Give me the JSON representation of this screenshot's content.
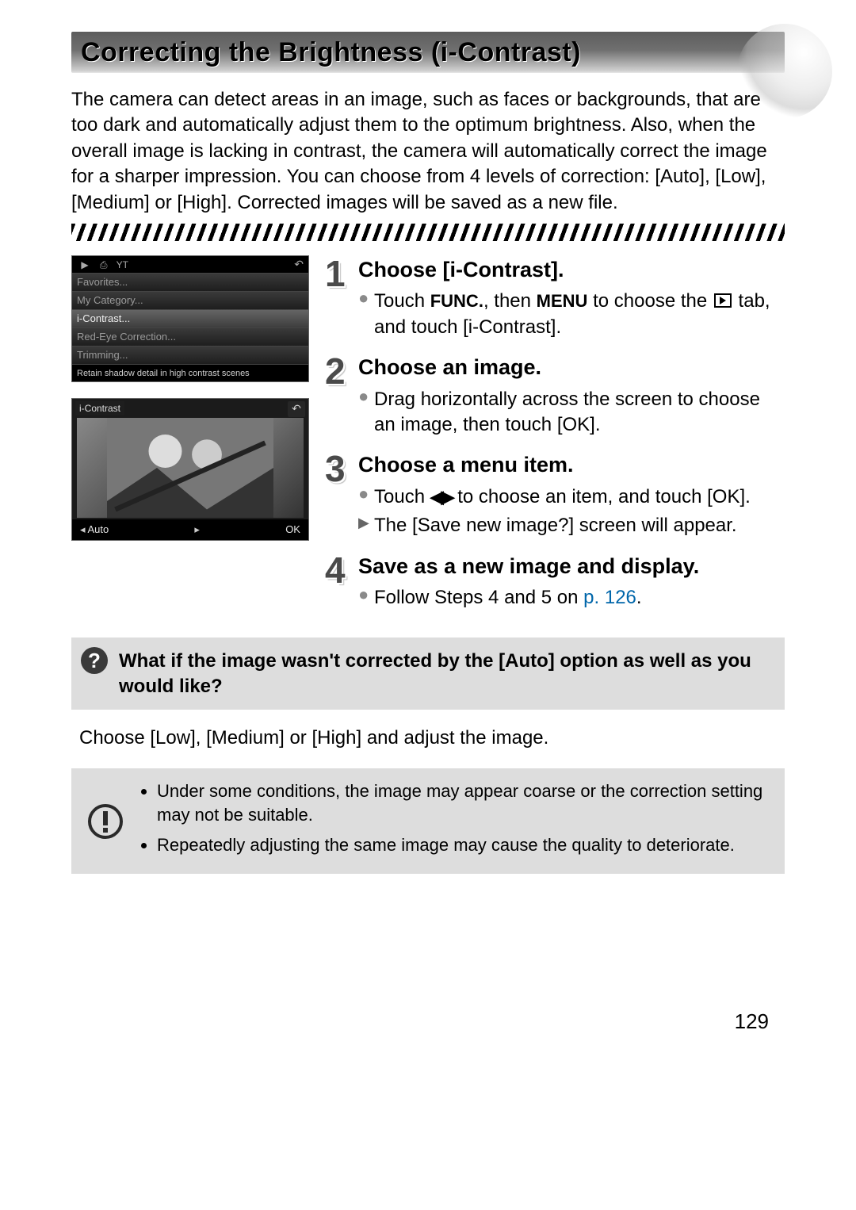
{
  "title": "Correcting the Brightness (i-Contrast)",
  "intro": "The camera can detect areas in an image, such as faces or backgrounds, that are too dark and automatically adjust them to the optimum brightness. Also, when the overall image is lacking in contrast, the camera will automatically correct the image for a sharper impression. You can choose from 4 levels of correction: [Auto], [Low], [Medium] or [High]. Corrected images will be saved as a new file.",
  "shot1": {
    "rows": [
      "Favorites...",
      "My Category...",
      "i-Contrast...",
      "Red-Eye Correction...",
      "Trimming..."
    ],
    "selected_index": 2,
    "footer": "Retain shadow detail in high contrast scenes"
  },
  "shot2": {
    "label": "i-Contrast",
    "setting": "Auto",
    "ok": "OK"
  },
  "steps": [
    {
      "title": "Choose [i-Contrast].",
      "bullets": [
        {
          "type": "dot",
          "parts": [
            "Touch ",
            "FUNC.",
            ", then ",
            "MENU",
            " to choose the ",
            "PLAY",
            " tab, and touch [i-Contrast]."
          ]
        }
      ]
    },
    {
      "title": "Choose an image.",
      "bullets": [
        {
          "type": "dot",
          "text": "Drag horizontally across the screen to choose an image, then touch [OK]."
        }
      ]
    },
    {
      "title": "Choose a menu item.",
      "bullets": [
        {
          "type": "dot",
          "parts": [
            "Touch ",
            "LR",
            " to choose an item, and touch [OK]."
          ]
        },
        {
          "type": "tri",
          "text": "The [Save new image?] screen will appear."
        }
      ]
    },
    {
      "title": "Save as a new image and display.",
      "bullets": [
        {
          "type": "dot",
          "parts": [
            "Follow Steps 4 and 5 on ",
            "LINK:p. 126",
            "."
          ]
        }
      ]
    }
  ],
  "question": "What if the image wasn't corrected by the [Auto] option as well as you would like?",
  "answer": "Choose [Low], [Medium] or [High] and adjust the image.",
  "warnings": [
    "Under some conditions, the image may appear coarse or the correction setting may not be suitable.",
    "Repeatedly adjusting the same image may cause the quality to deteriorate."
  ],
  "page_number": "129"
}
